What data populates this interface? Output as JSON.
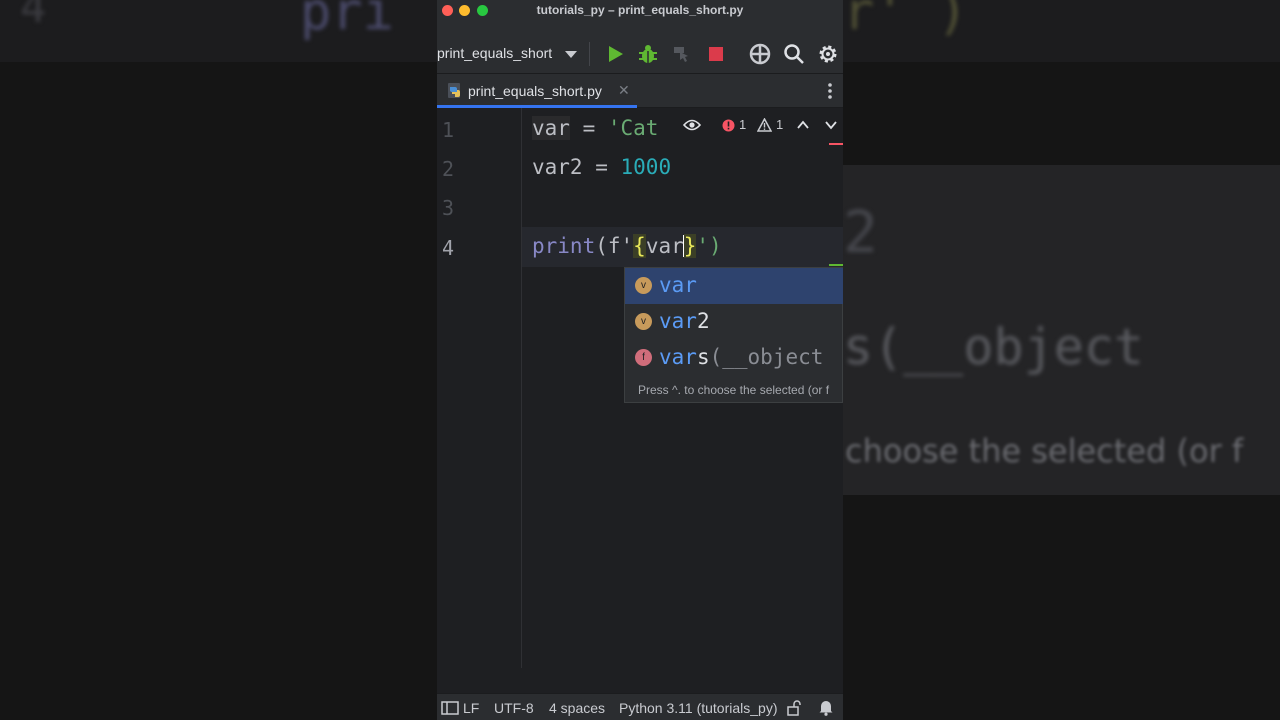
{
  "window": {
    "title": "tutorials_py – print_equals_short.py"
  },
  "toolbar": {
    "run_config": "print_equals_short",
    "icons": [
      "run-icon",
      "debug-icon",
      "coverage-icon",
      "stop-icon",
      "plugins-icon",
      "search-icon",
      "settings-icon"
    ]
  },
  "tab": {
    "label": "print_equals_short.py",
    "close": "✕"
  },
  "editor": {
    "lines": [
      {
        "num": "1",
        "text": "var = 'Cat"
      },
      {
        "num": "2",
        "text": "var2 = 1000"
      },
      {
        "num": "3",
        "text": ""
      },
      {
        "num": "4",
        "text": "print(f'{var}')"
      }
    ],
    "line1": {
      "name": "var",
      "op": " = ",
      "str": "'Cat"
    },
    "line2": {
      "name": "var2",
      "op": " = ",
      "num": "1000"
    },
    "line4": {
      "fn": "print",
      "open": "(f'",
      "brace_open": "{",
      "ident": "var",
      "brace_close": "}",
      "close": "')"
    },
    "inspection": {
      "errors": "1",
      "warnings": "1"
    }
  },
  "completion": {
    "items": [
      {
        "badge": "v",
        "match": "var",
        "rest": "",
        "sig": ""
      },
      {
        "badge": "v",
        "match": "var",
        "rest": "2",
        "sig": ""
      },
      {
        "badge": "f",
        "match": "var",
        "rest": "s",
        "sig": "(__object"
      }
    ],
    "hint": "Press ^. to choose the selected (or f"
  },
  "status": {
    "line_sep": "LF",
    "encoding": "UTF-8",
    "indent": "4 spaces",
    "interpreter": "Python 3.11 (tutorials_py)"
  },
  "backdrop": {
    "left_line_number": "4",
    "left_code": "pri",
    "right_top_code": "r' )",
    "right_mid_code": "2",
    "right_sig": "s(__object",
    "right_hint": "choose the selected (or f"
  },
  "colors": {
    "accent": "#3574f0",
    "editor_bg": "#1e1f22",
    "chrome_bg": "#2b2d30",
    "string": "#6aab73",
    "number": "#2aacb8",
    "builtin": "#8888c6",
    "error": "#f75464",
    "run_green": "#5fb832"
  }
}
